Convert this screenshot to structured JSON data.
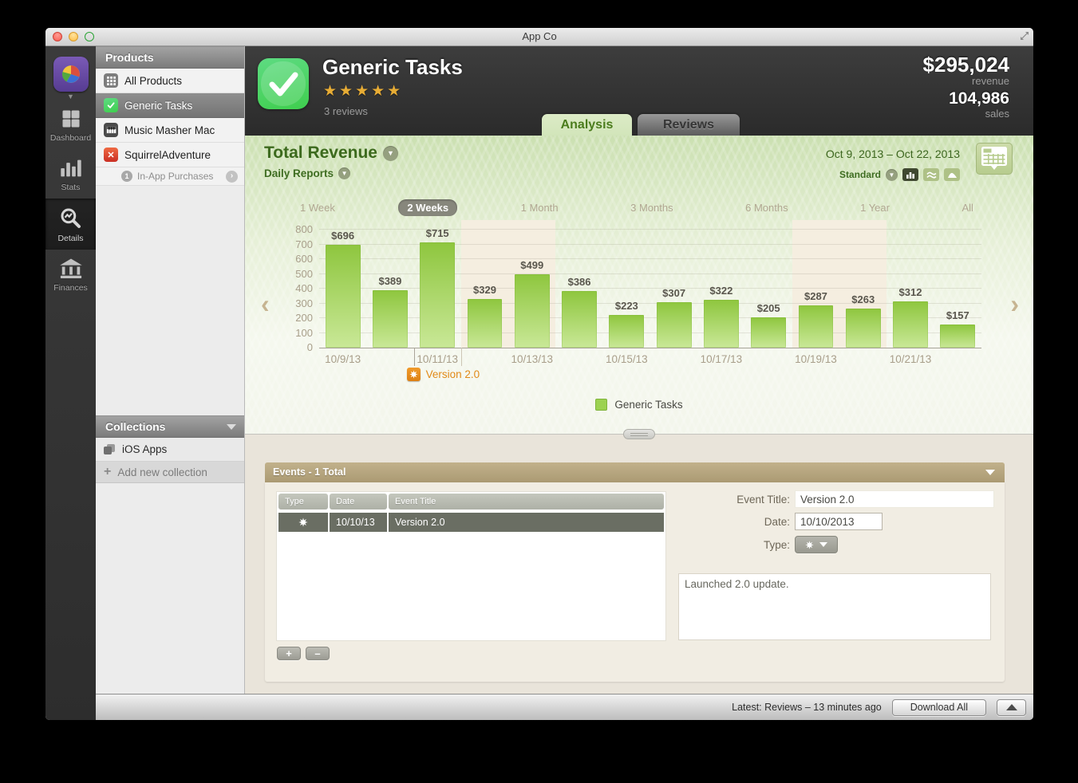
{
  "window": {
    "title": "App Co"
  },
  "rail": {
    "items": [
      {
        "id": "dashboard",
        "label": "Dashboard",
        "selected": false
      },
      {
        "id": "stats",
        "label": "Stats",
        "selected": false
      },
      {
        "id": "details",
        "label": "Details",
        "selected": true
      },
      {
        "id": "finances",
        "label": "Finances",
        "selected": false
      }
    ]
  },
  "sidebar": {
    "products_header": "Products",
    "products": [
      {
        "label": "All Products"
      },
      {
        "label": "Generic Tasks",
        "selected": true
      },
      {
        "label": "Music Masher Mac"
      },
      {
        "label": "SquirrelAdventure"
      }
    ],
    "iap_badge": "1",
    "iap_label": "In-App Purchases",
    "collections_header": "Collections",
    "collection_item": "iOS Apps",
    "add_collection_label": "Add new collection"
  },
  "header": {
    "app_name": "Generic Tasks",
    "stars": "★★★★★",
    "reviews": "3 reviews",
    "revenue": "$295,024",
    "revenue_label": "revenue",
    "sales": "104,986",
    "sales_label": "sales"
  },
  "tabs": {
    "analysis": "Analysis",
    "reviews": "Reviews"
  },
  "analysis": {
    "title": "Total Revenue",
    "subtitle": "Daily Reports",
    "date_range": "Oct 9, 2013 – Oct 22, 2013",
    "view_mode": "Standard",
    "ranges": [
      "1 Week",
      "2 Weeks",
      "1 Month",
      "3 Months",
      "6 Months",
      "1 Year",
      "All"
    ],
    "selected_range": "2 Weeks"
  },
  "chart_data": {
    "type": "bar",
    "title": "Total Revenue – Daily Reports",
    "x": [
      "10/9/13",
      "10/10/13",
      "10/11/13",
      "10/12/13",
      "10/13/13",
      "10/14/13",
      "10/15/13",
      "10/16/13",
      "10/17/13",
      "10/18/13",
      "10/19/13",
      "10/20/13",
      "10/21/13",
      "10/22/13"
    ],
    "values": [
      696,
      389,
      715,
      329,
      499,
      386,
      223,
      307,
      322,
      205,
      287,
      263,
      312,
      157
    ],
    "bar_labels": [
      "$696",
      "$389",
      "$715",
      "$329",
      "$499",
      "$386",
      "$223",
      "$307",
      "$322",
      "$205",
      "$287",
      "$263",
      "$312",
      "$157"
    ],
    "x_tick_labels": [
      "10/9/13",
      "10/11/13",
      "10/13/13",
      "10/15/13",
      "10/17/13",
      "10/19/13",
      "10/21/13"
    ],
    "ylim": [
      0,
      800
    ],
    "ytick_step": 100,
    "grid": true,
    "legend_position": "bottom-center",
    "weekend_band_slots": [
      [
        3,
        4
      ],
      [
        10,
        11
      ]
    ],
    "event_marker": {
      "boundary_after_slot": 1,
      "label": "Version 2.0"
    },
    "legend": [
      {
        "name": "Generic Tasks",
        "color": "#9cd251"
      }
    ],
    "bar_color_top": "#8ec63e",
    "bar_color_bottom": "#c9e897",
    "band_color": "#f5eee0"
  },
  "events": {
    "header": "Events - 1 Total",
    "columns": [
      "Type",
      "Date",
      "Event Title"
    ],
    "rows": [
      {
        "date": "10/10/13",
        "title": "Version 2.0",
        "selected": true
      }
    ],
    "form": {
      "title_label": "Event Title:",
      "title_value": "Version 2.0",
      "date_label": "Date:",
      "date_value": "10/10/2013",
      "type_label": "Type:",
      "notes_value": "Launched 2.0 update."
    },
    "add_label": "+",
    "remove_label": "–"
  },
  "statusbar": {
    "latest": "Latest: Reviews – 13 minutes ago",
    "download_label": "Download All"
  }
}
